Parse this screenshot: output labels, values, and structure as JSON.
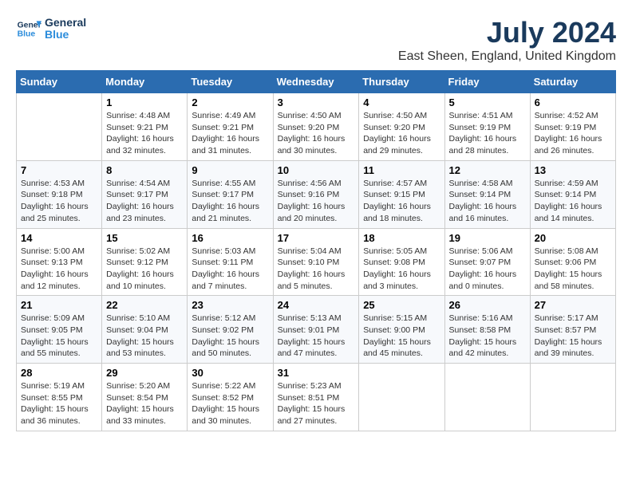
{
  "header": {
    "logo_line1": "General",
    "logo_line2": "Blue",
    "month_title": "July 2024",
    "location": "East Sheen, England, United Kingdom"
  },
  "columns": [
    "Sunday",
    "Monday",
    "Tuesday",
    "Wednesday",
    "Thursday",
    "Friday",
    "Saturday"
  ],
  "weeks": [
    [
      {
        "num": "",
        "info": ""
      },
      {
        "num": "1",
        "info": "Sunrise: 4:48 AM\nSunset: 9:21 PM\nDaylight: 16 hours\nand 32 minutes."
      },
      {
        "num": "2",
        "info": "Sunrise: 4:49 AM\nSunset: 9:21 PM\nDaylight: 16 hours\nand 31 minutes."
      },
      {
        "num": "3",
        "info": "Sunrise: 4:50 AM\nSunset: 9:20 PM\nDaylight: 16 hours\nand 30 minutes."
      },
      {
        "num": "4",
        "info": "Sunrise: 4:50 AM\nSunset: 9:20 PM\nDaylight: 16 hours\nand 29 minutes."
      },
      {
        "num": "5",
        "info": "Sunrise: 4:51 AM\nSunset: 9:19 PM\nDaylight: 16 hours\nand 28 minutes."
      },
      {
        "num": "6",
        "info": "Sunrise: 4:52 AM\nSunset: 9:19 PM\nDaylight: 16 hours\nand 26 minutes."
      }
    ],
    [
      {
        "num": "7",
        "info": "Sunrise: 4:53 AM\nSunset: 9:18 PM\nDaylight: 16 hours\nand 25 minutes."
      },
      {
        "num": "8",
        "info": "Sunrise: 4:54 AM\nSunset: 9:17 PM\nDaylight: 16 hours\nand 23 minutes."
      },
      {
        "num": "9",
        "info": "Sunrise: 4:55 AM\nSunset: 9:17 PM\nDaylight: 16 hours\nand 21 minutes."
      },
      {
        "num": "10",
        "info": "Sunrise: 4:56 AM\nSunset: 9:16 PM\nDaylight: 16 hours\nand 20 minutes."
      },
      {
        "num": "11",
        "info": "Sunrise: 4:57 AM\nSunset: 9:15 PM\nDaylight: 16 hours\nand 18 minutes."
      },
      {
        "num": "12",
        "info": "Sunrise: 4:58 AM\nSunset: 9:14 PM\nDaylight: 16 hours\nand 16 minutes."
      },
      {
        "num": "13",
        "info": "Sunrise: 4:59 AM\nSunset: 9:14 PM\nDaylight: 16 hours\nand 14 minutes."
      }
    ],
    [
      {
        "num": "14",
        "info": "Sunrise: 5:00 AM\nSunset: 9:13 PM\nDaylight: 16 hours\nand 12 minutes."
      },
      {
        "num": "15",
        "info": "Sunrise: 5:02 AM\nSunset: 9:12 PM\nDaylight: 16 hours\nand 10 minutes."
      },
      {
        "num": "16",
        "info": "Sunrise: 5:03 AM\nSunset: 9:11 PM\nDaylight: 16 hours\nand 7 minutes."
      },
      {
        "num": "17",
        "info": "Sunrise: 5:04 AM\nSunset: 9:10 PM\nDaylight: 16 hours\nand 5 minutes."
      },
      {
        "num": "18",
        "info": "Sunrise: 5:05 AM\nSunset: 9:08 PM\nDaylight: 16 hours\nand 3 minutes."
      },
      {
        "num": "19",
        "info": "Sunrise: 5:06 AM\nSunset: 9:07 PM\nDaylight: 16 hours\nand 0 minutes."
      },
      {
        "num": "20",
        "info": "Sunrise: 5:08 AM\nSunset: 9:06 PM\nDaylight: 15 hours\nand 58 minutes."
      }
    ],
    [
      {
        "num": "21",
        "info": "Sunrise: 5:09 AM\nSunset: 9:05 PM\nDaylight: 15 hours\nand 55 minutes."
      },
      {
        "num": "22",
        "info": "Sunrise: 5:10 AM\nSunset: 9:04 PM\nDaylight: 15 hours\nand 53 minutes."
      },
      {
        "num": "23",
        "info": "Sunrise: 5:12 AM\nSunset: 9:02 PM\nDaylight: 15 hours\nand 50 minutes."
      },
      {
        "num": "24",
        "info": "Sunrise: 5:13 AM\nSunset: 9:01 PM\nDaylight: 15 hours\nand 47 minutes."
      },
      {
        "num": "25",
        "info": "Sunrise: 5:15 AM\nSunset: 9:00 PM\nDaylight: 15 hours\nand 45 minutes."
      },
      {
        "num": "26",
        "info": "Sunrise: 5:16 AM\nSunset: 8:58 PM\nDaylight: 15 hours\nand 42 minutes."
      },
      {
        "num": "27",
        "info": "Sunrise: 5:17 AM\nSunset: 8:57 PM\nDaylight: 15 hours\nand 39 minutes."
      }
    ],
    [
      {
        "num": "28",
        "info": "Sunrise: 5:19 AM\nSunset: 8:55 PM\nDaylight: 15 hours\nand 36 minutes."
      },
      {
        "num": "29",
        "info": "Sunrise: 5:20 AM\nSunset: 8:54 PM\nDaylight: 15 hours\nand 33 minutes."
      },
      {
        "num": "30",
        "info": "Sunrise: 5:22 AM\nSunset: 8:52 PM\nDaylight: 15 hours\nand 30 minutes."
      },
      {
        "num": "31",
        "info": "Sunrise: 5:23 AM\nSunset: 8:51 PM\nDaylight: 15 hours\nand 27 minutes."
      },
      {
        "num": "",
        "info": ""
      },
      {
        "num": "",
        "info": ""
      },
      {
        "num": "",
        "info": ""
      }
    ]
  ]
}
